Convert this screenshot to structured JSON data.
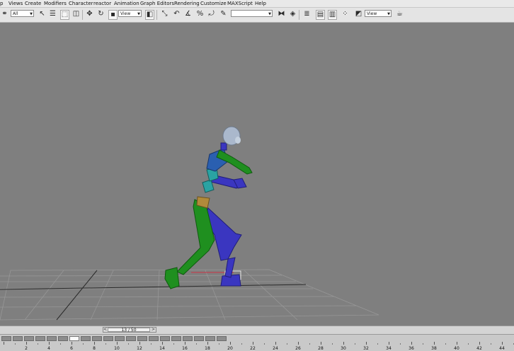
{
  "menu": [
    "p",
    "Views",
    "Create",
    "Modifiers",
    "Character",
    "reactor",
    "Animation",
    "Graph Editors",
    "Rendering",
    "Customize",
    "MAXScript",
    "Help"
  ],
  "toolbar": {
    "selection_filter": "All",
    "reference_coord": "View",
    "named_selection": "",
    "render_view": "View"
  },
  "time_slider": {
    "label": "13 / 50",
    "prev": "<",
    "next": ">"
  },
  "frame_ticks": [
    "2",
    "4",
    "6",
    "8",
    "10",
    "12",
    "14",
    "16",
    "18",
    "20",
    "22",
    "24",
    "26",
    "28",
    "30",
    "32",
    "34",
    "36",
    "38",
    "40",
    "42",
    "44",
    "46"
  ],
  "colors": {
    "viewport_bg": "#7f7f7f",
    "grid": "#9a9a9a",
    "biped_green": "#1f8f1f",
    "biped_blue": "#3a36c0",
    "biped_cyan": "#2aa3a3",
    "head": "#aab8cc"
  }
}
